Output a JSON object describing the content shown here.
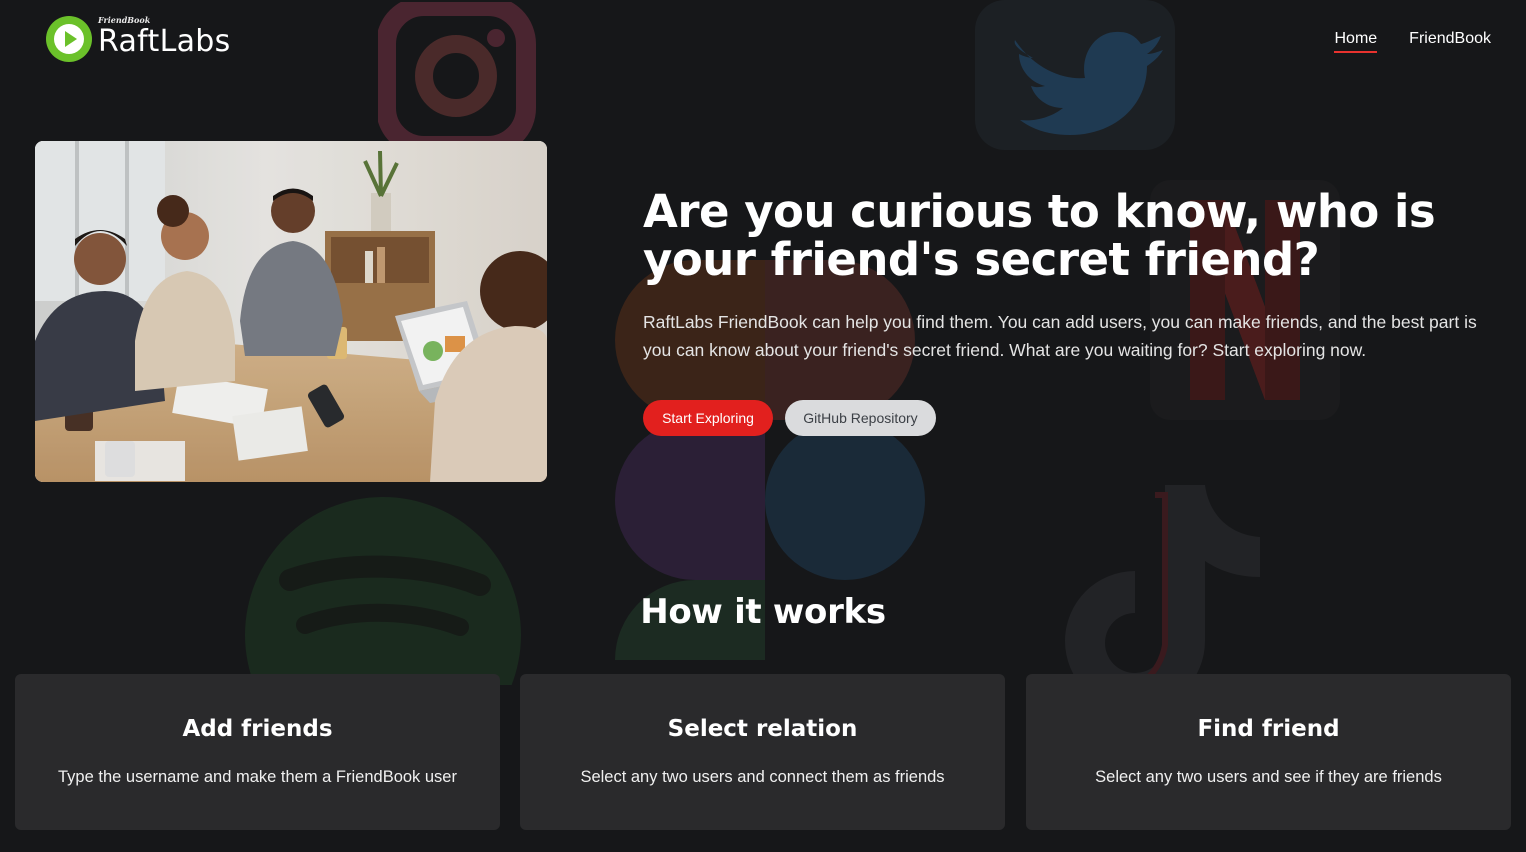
{
  "header": {
    "logo_sub": "FriendBook",
    "logo_name": "RaftLabs",
    "nav": [
      {
        "label": "Home",
        "active": true
      },
      {
        "label": "FriendBook",
        "active": false
      }
    ]
  },
  "hero": {
    "title": "Are you curious to know, who is your friend's secret friend?",
    "description": "RaftLabs FriendBook can help you find them. You can add users, you can make friends, and the best part is you can know about your friend's secret friend. What are you waiting for? Start exploring now.",
    "primary_button": "Start Exploring",
    "secondary_button": "GitHub Repository"
  },
  "how_it_works": {
    "title": "How it works",
    "cards": [
      {
        "title": "Add friends",
        "description": "Type the username and make them a FriendBook user"
      },
      {
        "title": "Select relation",
        "description": "Select any two users and connect them as friends"
      },
      {
        "title": "Find friend",
        "description": "Select any two users and see if they are friends"
      }
    ]
  },
  "colors": {
    "background": "#161719",
    "accent": "#e2201e",
    "logo_green": "#6bc12a",
    "card": "#2a2a2c",
    "secondary_button": "#dadbdd"
  },
  "icons": [
    "play-logo-icon",
    "instagram-icon",
    "twitter-icon",
    "netflix-icon",
    "figma-icon",
    "spotify-icon",
    "tiktok-icon"
  ]
}
